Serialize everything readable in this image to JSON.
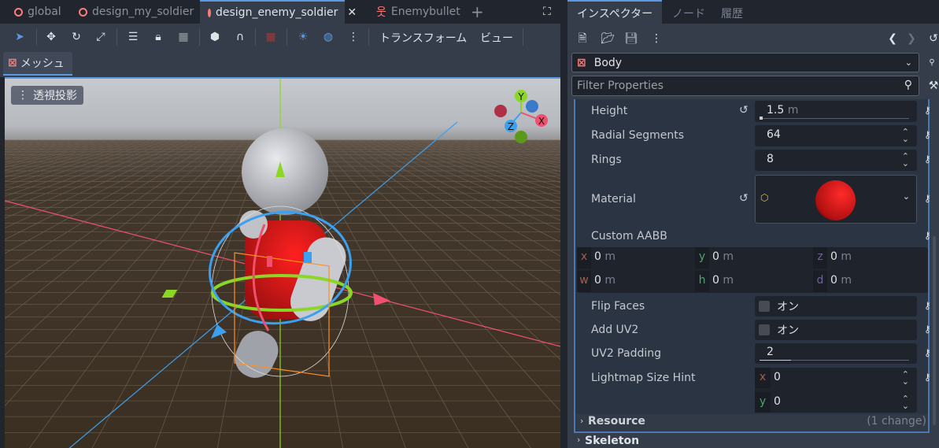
{
  "scene_tabs": [
    {
      "label": "global",
      "icon": "scene-ring-icon"
    },
    {
      "label": "design_my_soldier",
      "icon": "scene-ring-icon"
    },
    {
      "label": "design_enemy_soldier",
      "icon": "scene-ring-icon",
      "active": true
    },
    {
      "label": "Enemybullet",
      "icon": "character-icon"
    }
  ],
  "toolbar": {
    "transform_menu": "トランスフォーム",
    "view_menu": "ビュー"
  },
  "mesh_menu": "メッシュ",
  "viewport": {
    "projection_button": "透視投影",
    "gizmo": {
      "y": "Y",
      "x": "X",
      "z": "Z"
    }
  },
  "inspector": {
    "tabs": [
      "インスペクター",
      "ノード",
      "履歴"
    ],
    "object_name": "Body",
    "filter_placeholder": "Filter Properties",
    "properties": {
      "height": {
        "label": "Height",
        "value": "1.5",
        "unit": "m",
        "slider": 0.01
      },
      "radial_segments": {
        "label": "Radial Segments",
        "value": "64"
      },
      "rings": {
        "label": "Rings",
        "value": "8"
      },
      "material": {
        "label": "Material"
      },
      "custom_aabb": {
        "label": "Custom AABB",
        "x": "0",
        "y": "0",
        "z": "0",
        "w": "0",
        "h": "0",
        "d": "0",
        "unit": "m"
      },
      "flip_faces": {
        "label": "Flip Faces",
        "value": "オン",
        "checked": false
      },
      "add_uv2": {
        "label": "Add UV2",
        "value": "オン",
        "checked": false
      },
      "uv2_padding": {
        "label": "UV2 Padding",
        "value": "2",
        "slider": 0.2
      },
      "lightmap_size_hint": {
        "label": "Lightmap Size Hint",
        "x": "0",
        "y": "0"
      }
    },
    "sections": {
      "resource": "Resource",
      "resource_changes": "(1 change)",
      "skeleton": "Skeleton"
    },
    "axis_letters": {
      "x": "x",
      "y": "y",
      "z": "z",
      "w": "w",
      "h": "h",
      "d": "d"
    }
  },
  "colors": {
    "accent": "#5b9ae0",
    "x_axis": "#f0506e",
    "y_axis": "#8ad726",
    "z_axis": "#3ca0f0",
    "mesh_red": "#e01818"
  }
}
